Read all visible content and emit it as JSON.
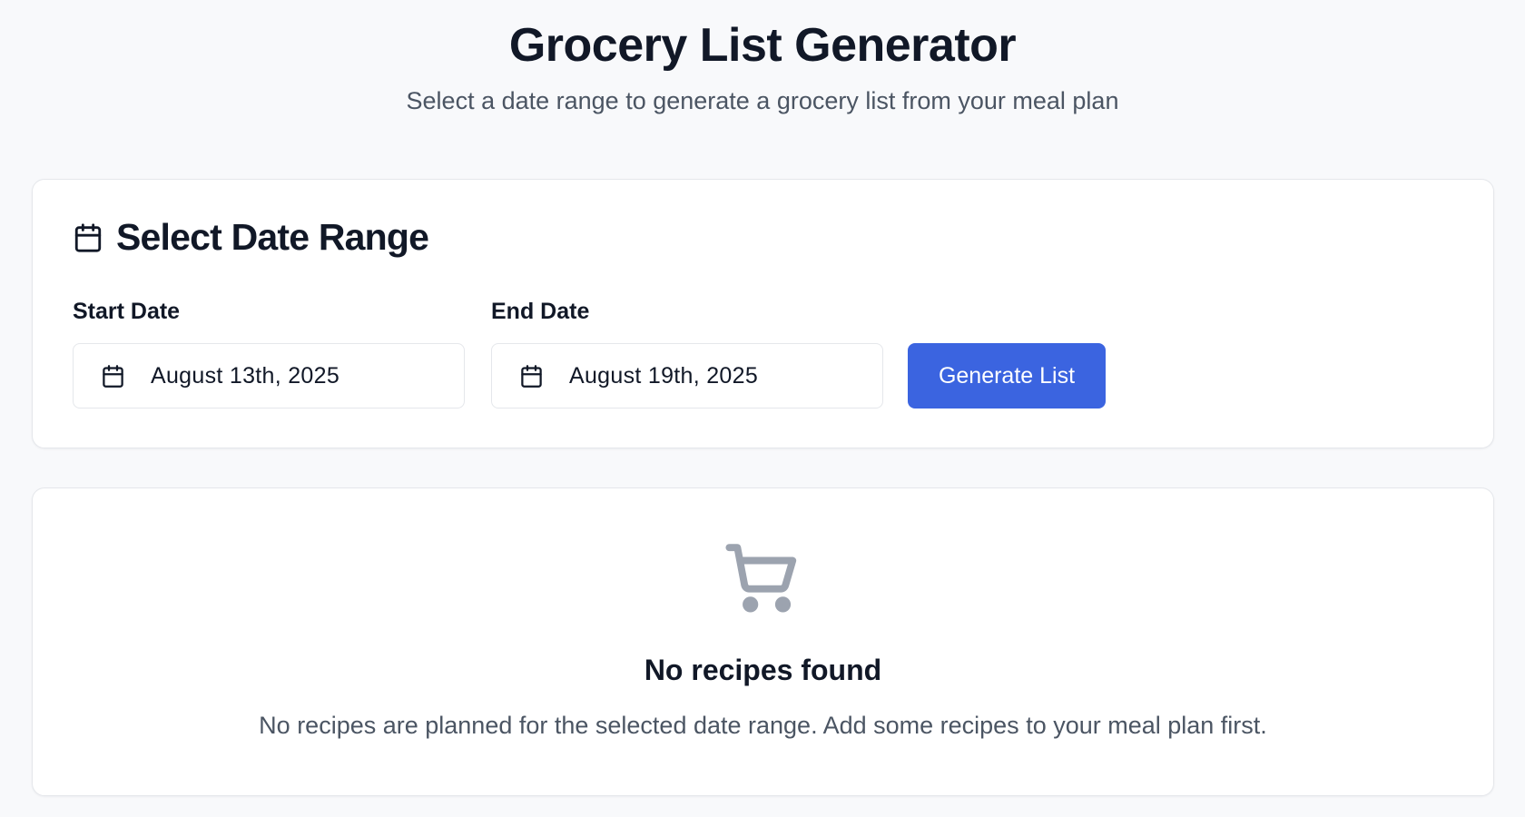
{
  "header": {
    "title": "Grocery List Generator",
    "subtitle": "Select a date range to generate a grocery list from your meal plan"
  },
  "date_range_card": {
    "title": "Select Date Range",
    "title_icon": "calendar-icon",
    "start_date": {
      "label": "Start Date",
      "value": "August 13th, 2025",
      "icon": "calendar-icon"
    },
    "end_date": {
      "label": "End Date",
      "value": "August 19th, 2025",
      "icon": "calendar-icon"
    },
    "generate_button_label": "Generate List"
  },
  "empty_state": {
    "icon": "shopping-cart-icon",
    "title": "No recipes found",
    "description": "No recipes are planned for the selected date range. Add some recipes to your meal plan first."
  },
  "colors": {
    "page_background": "#f8f9fb",
    "primary_button": "#3b64e0",
    "muted_icon": "#9ca3af",
    "muted_text": "#4b5563"
  }
}
